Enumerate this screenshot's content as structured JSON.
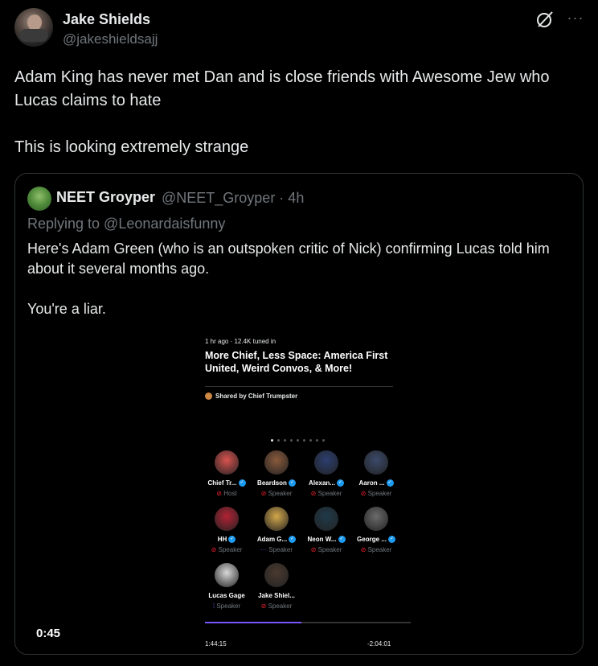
{
  "tweet": {
    "author_name": "Jake Shields",
    "author_handle": "@jakeshieldsajj",
    "text": "Adam King has never met Dan and is close friends with Awesome Jew who Lucas claims to hate\n\nThis is looking extremely strange",
    "more_label": "···"
  },
  "quote": {
    "author_name": "NEET Groyper",
    "author_handle_time": "@NEET_Groyper · 4h",
    "replying_to": "Replying to @Leonardaisfunny",
    "text": "Here's Adam Green (who is an outspoken critic of Nick) confirming Lucas told him about it several months ago.\n\nYou're a liar."
  },
  "space": {
    "meta": "1 hr ago · 12.4K tuned in",
    "title": "More Chief, Less Space: America First United, Weird Convos, & More!",
    "shared_by": "Shared by Chief Trumpster",
    "speakers": [
      {
        "name": "Chief Tr...",
        "role": "Host",
        "verified": true,
        "mic": "muted",
        "color": "#d9534f"
      },
      {
        "name": "Beardson",
        "role": "Speaker",
        "verified": true,
        "mic": "muted",
        "color": "#8a5a3c"
      },
      {
        "name": "Alexan...",
        "role": "Speaker",
        "verified": true,
        "mic": "muted",
        "color": "#2c3e70"
      },
      {
        "name": "Aaron ...",
        "role": "Speaker",
        "verified": true,
        "mic": "muted",
        "color": "#3b4a6b"
      },
      {
        "name": "HH",
        "role": "Speaker",
        "verified": true,
        "mic": "muted",
        "color": "#b22234"
      },
      {
        "name": "Adam G...",
        "role": "Speaker",
        "verified": true,
        "mic": "speaking",
        "color": "#d4a84b"
      },
      {
        "name": "Neon W...",
        "role": "Speaker",
        "verified": true,
        "mic": "muted",
        "color": "#1f3a4a"
      },
      {
        "name": "George ...",
        "role": "Speaker",
        "verified": true,
        "mic": "muted",
        "color": "#6b6b6b"
      },
      {
        "name": "Lucas Gage",
        "role": "Speaker",
        "verified": false,
        "mic": "talking",
        "color": "#d8d8d8"
      },
      {
        "name": "Jake Shiel...",
        "role": "Speaker",
        "verified": false,
        "mic": "muted",
        "color": "#4a3a30"
      }
    ]
  },
  "video": {
    "timestamp": "0:45",
    "elapsed": "1:44:15",
    "remaining": "-2:04:01",
    "progress_fraction": 0.47
  }
}
